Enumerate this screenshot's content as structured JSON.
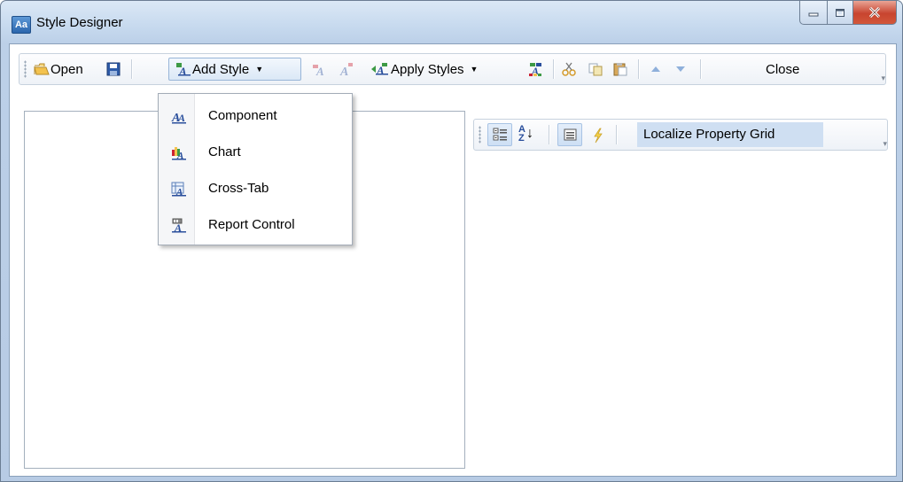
{
  "window": {
    "title": "Style Designer",
    "app_icon_text": "Aa"
  },
  "toolbar": {
    "open_label": "Open",
    "add_style_label": "Add Style",
    "apply_styles_label": "Apply Styles",
    "close_label": "Close"
  },
  "add_style_menu": {
    "items": [
      {
        "label": "Component",
        "icon": "component-style-icon"
      },
      {
        "label": "Chart",
        "icon": "chart-style-icon"
      },
      {
        "label": "Cross-Tab",
        "icon": "crosstab-style-icon"
      },
      {
        "label": "Report Control",
        "icon": "report-control-style-icon"
      }
    ]
  },
  "property_grid": {
    "localize_label": "Localize Property Grid"
  },
  "colors": {
    "accent": "#cfdff2",
    "title_bar": "#c6d9ee",
    "close_button": "#c8442f"
  }
}
